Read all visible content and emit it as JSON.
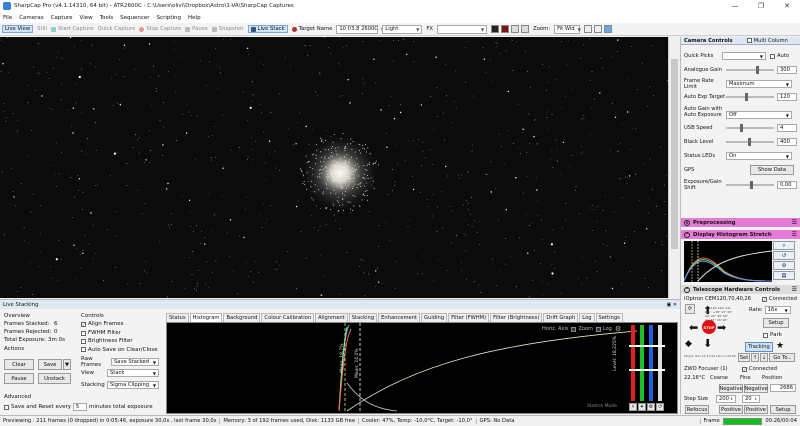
{
  "window": {
    "title": "SharpCap Pro (v4.1.14310, 64 bit) - ATR2600C - C:\\Users\\olivi\\Dropbox\\Astro\\1-VA\\SharpCap Captures",
    "controls": [
      "—",
      "❐",
      "✕"
    ]
  },
  "menu": [
    "File",
    "Cameras",
    "Capture",
    "View",
    "Tools",
    "Sequencer",
    "Scripting",
    "Help"
  ],
  "toolbar": {
    "live_view": "Live View",
    "still": "Still",
    "start_capture": "Start Capture",
    "quick_capture": "Quick Capture",
    "stop_capture": "Stop Capture",
    "pause": "Pause",
    "snapshot": "Snapshot",
    "live_stack": "Live Stack",
    "target_name_label": "Target Name",
    "target_name_value": "10 f/3.8 2600C",
    "frame_type_value": "Light",
    "fx_label": "FX",
    "zoom_label": "Zoom:",
    "zoom_value": "Fit Wid"
  },
  "camera_controls": {
    "header": "Camera Controls",
    "multi_column": "Multi Column",
    "quick_picks_label": "Quick Picks",
    "auto_label": "Auto",
    "analogue_gain_label": "Analogue Gain",
    "analogue_gain_value": "300",
    "frame_rate_label": "Frame Rate Limit",
    "frame_rate_value": "Maximum",
    "auto_exp_target_label": "Auto Exp Target",
    "auto_exp_target_value": "120",
    "auto_gain_label": "Auto Gain with Auto Exposure",
    "auto_gain_value": "Off",
    "usb_speed_label": "USB Speed",
    "usb_speed_value": "4",
    "black_level_label": "Black Level",
    "black_level_value": "400",
    "status_leds_label": "Status LEDs",
    "status_leds_value": "On",
    "gps_label": "GPS",
    "show_data_btn": "Show Data",
    "expgain_shift_label": "Exposure/Gain Shift",
    "expgain_shift_value": "0,00"
  },
  "sections": {
    "preprocessing": "Preprocessing",
    "display_stretch": "Display Histogram Stretch",
    "telescope": "Telescope Hardware Controls"
  },
  "telescope": {
    "mount_name": "iOptron CEM120,70,40,26",
    "connected": "Connected",
    "rate_label": "Rate:",
    "rate_value": "16x",
    "stop_label": "STOP",
    "setup_btn": "Setup",
    "park_btn": "Park",
    "tracking_btn": "Tracking",
    "set_btn": "Set",
    "goto_btn": "Go To..",
    "target_line": "Target: RA=14:17:54 Dec=+39:08:55",
    "coords": [
      "RA: 16h 41m 41s",
      "Dec: +36° 27' 39\"",
      "Alt: 21° 36' 00\"",
      "Az: 44° 16' 00\""
    ]
  },
  "focuser": {
    "name": "ZWO Focuser (1)",
    "connected": "Connected",
    "temp": "22,16°C",
    "coarse": "Coarse",
    "fine": "Fine",
    "position_label": "Position",
    "position_value": "2686",
    "negative1": "Negative",
    "negative2": "Negative",
    "step_size_label": "Step Size",
    "step_coarse": "200",
    "step_fine": "20",
    "refocus": "Refocus",
    "positive1": "Positive",
    "positive2": "Positive",
    "setup": "Setup"
  },
  "live_stacking": {
    "header": "Live Stacking",
    "overview_label": "Overview",
    "frames_stacked_label": "Frames Stacked:",
    "frames_stacked_value": "6",
    "frames_rejected_label": "Frames Rejected:",
    "frames_rejected_value": "0",
    "total_exposure_label": "Total Exposure:",
    "total_exposure_value": "3m 0s",
    "actions_label": "Actions",
    "clear_btn": "Clear",
    "save_btn": "Save",
    "pause_btn": "Pause",
    "unstack_btn": "Unstack",
    "advanced_label": "Advanced",
    "save_reset_label": "Save and Reset every",
    "save_reset_value": "5",
    "save_reset_units": "minutes total exposure",
    "controls_label": "Controls",
    "align_frames": "Align Frames",
    "fwhm_filter": "FWHM Filter",
    "brightness_filter": "Brightness Filter",
    "auto_save": "Auto Save on Clear/Close",
    "raw_frames_label": "Raw Frames",
    "raw_frames_value": "Save Stacked",
    "view_label": "View",
    "view_value": "Stack",
    "stacking_label": "Stacking",
    "stacking_value": "Sigma Clipping",
    "tabs": [
      "Status",
      "Histogram",
      "Background",
      "Colour Calibration",
      "Alignment",
      "Stacking",
      "Enhancement",
      "Guiding",
      "Filter (FWHM)",
      "Filter (Brightness)",
      "Drift Graph",
      "Log",
      "Settings"
    ],
    "active_tab": "Histogram",
    "histo_axis_label": "Horiz. Axis",
    "zoom_label": "Zoom",
    "log_label": "Log",
    "stretch_mode": "Stretch Mode",
    "level_text": "Level:",
    "level_value": "18,225%",
    "mean_label_1": "Mean: 18.7%",
    "mean_label_2": "Mean: 24.0%"
  },
  "status": {
    "previewing": "Previewing : 211 frames (0 dropped) in 0:05:46, exposure 30,0s , last frame 30,0s",
    "memory": "Memory: 3 of 192 frames used, Disk: 1133 GB free",
    "cooler": "Cooler: 47%, Temp: -10,0°C, Target: -10,0°",
    "gps": "GPS: No Data",
    "frame_label": "Frame",
    "time": "00:26/00:04"
  },
  "colors": {
    "accent_pink": "#e57bd6",
    "stop_red": "#e01010",
    "progress_green": "#10c020"
  }
}
